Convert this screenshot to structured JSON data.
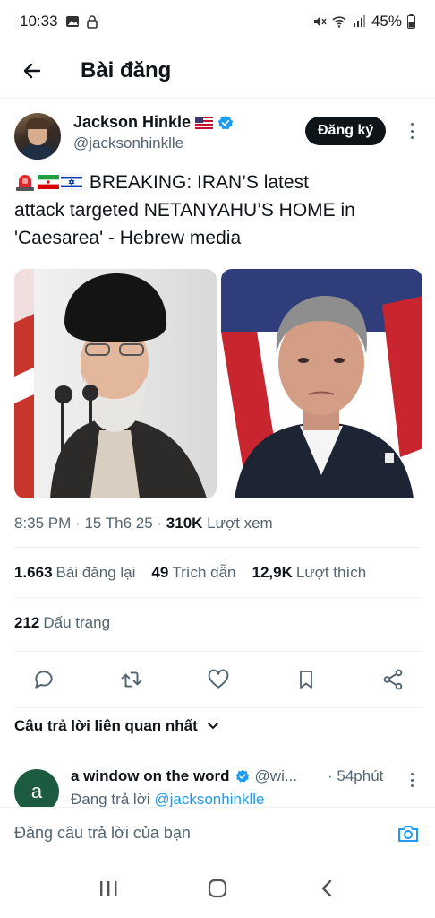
{
  "status_bar": {
    "time": "10:33",
    "battery": "45%",
    "icons_left": [
      "image-icon",
      "lock-icon"
    ],
    "icons_right": [
      "mute-icon",
      "wifi-icon",
      "signal-icon",
      "battery-icon"
    ]
  },
  "header": {
    "title": "Bài đăng",
    "back_icon": "arrow-left-icon"
  },
  "post": {
    "author_name": "Jackson Hinkle",
    "author_flag": "us-flag-icon",
    "author_handle": "@jacksonhinklle",
    "subscribe_label": "Đăng ký",
    "emojis": [
      "rotating-light-icon",
      "iran-flag-icon",
      "israel-flag-icon"
    ],
    "text_line1": " BREAKING: IRAN’S latest",
    "text_line2": "attack targeted NETANYAHU’S HOME in",
    "text_line3": "'Caesarea'  - Hebrew media",
    "time": "8:35 PM",
    "date": "15 Th6 25",
    "views_count": "310K",
    "views_label": "Lượt xem",
    "reposts_count": "1.663",
    "reposts_label": "Bài đăng lại",
    "quotes_count": "49",
    "quotes_label": "Trích dẫn",
    "likes_count": "12,9K",
    "likes_label": "Lượt thích",
    "bookmarks_count": "212",
    "bookmarks_label": "Dấu trang"
  },
  "actions": [
    "reply-icon",
    "repost-icon",
    "like-icon",
    "bookmark-icon",
    "share-icon"
  ],
  "replies": {
    "sort_label": "Câu trả lời liên quan nhất",
    "items": [
      {
        "avatar_letter": "a",
        "name": "a window on the word",
        "handle": "@wi...",
        "time": "· 54phút",
        "replying_prefix": "Đang trả lời ",
        "replying_to": "@jacksonhinklle"
      }
    ]
  },
  "composer": {
    "placeholder": "Đăng câu trả lời của bạn"
  },
  "colors": {
    "accent": "#1d9bf0",
    "text": "#0f1419",
    "muted": "#536471",
    "verified": "#1d9bf0"
  }
}
